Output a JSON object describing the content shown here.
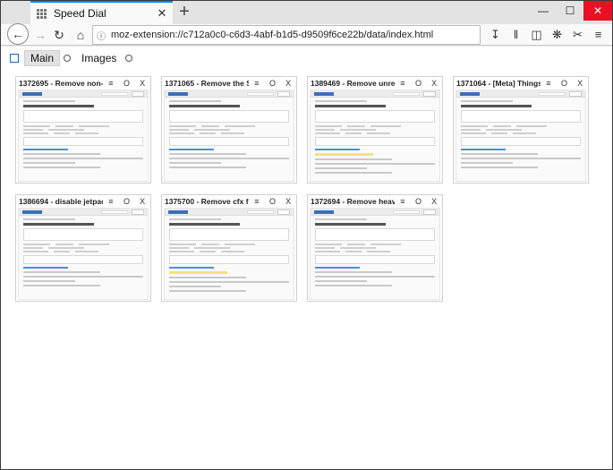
{
  "browser": {
    "tab_title": "Speed Dial",
    "tab_close": "✕",
    "new_tab": "+",
    "url": "moz-extension://c712a0c0-c6d3-4abf-b1d5-d9509f6ce22b/data/index.html"
  },
  "groups": [
    {
      "label": "Main"
    },
    {
      "label": "Images"
    }
  ],
  "dial_actions": {
    "menu": "≡",
    "refresh": "O",
    "close": "X"
  },
  "dials": [
    {
      "title": "1372695 - Remove non-r"
    },
    {
      "title": "1371065 - Remove the S"
    },
    {
      "title": "1389469 - Remove unre"
    },
    {
      "title": "1371064 - [Meta] Things"
    },
    {
      "title": "1386694 - disable jetpac"
    },
    {
      "title": "1375700 - Remove cfx fr"
    },
    {
      "title": "1372694 - Remove heav"
    }
  ]
}
